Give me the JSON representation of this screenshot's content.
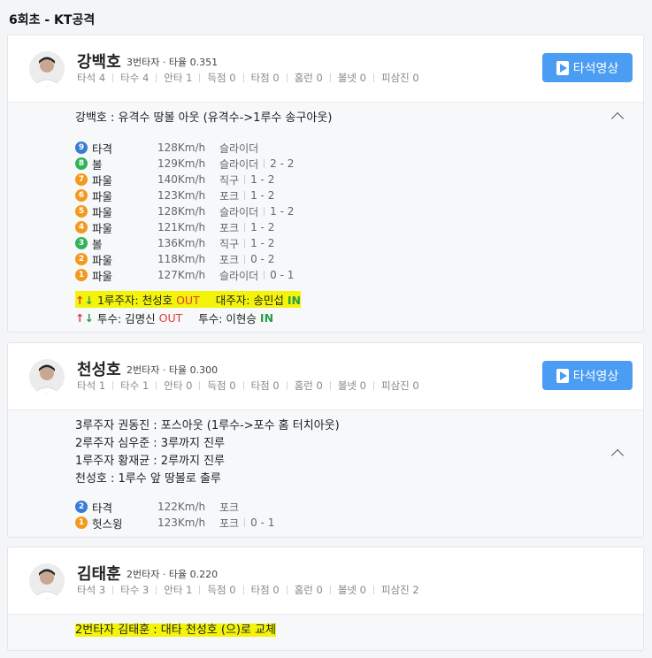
{
  "inning": {
    "title": "6회초 - KT공격"
  },
  "colors": {
    "accent": "#4a9df2",
    "out": "#e03b3b",
    "in": "#2a9d4a",
    "highlight": "#f4f40a"
  },
  "batters": [
    {
      "name": "강백호",
      "order": "3번타자 · 타율 0.351",
      "stats": [
        "타석 4",
        "타수 4",
        "안타 1",
        "득점 0",
        "타점 0",
        "홈런 0",
        "볼넷 0",
        "피삼진 0"
      ],
      "video_label": "타석영상",
      "result": "강백호 : 유격수 땅볼 아웃 (유격수->1루수 송구아웃)",
      "pitches": [
        {
          "n": "9",
          "c": "blue",
          "res": "타격",
          "speed": "128Km/h",
          "type": "슬라이더",
          "count": ""
        },
        {
          "n": "8",
          "c": "green",
          "res": "볼",
          "speed": "129Km/h",
          "type": "슬라이더",
          "count": "2 - 2"
        },
        {
          "n": "7",
          "c": "orange",
          "res": "파울",
          "speed": "140Km/h",
          "type": "직구",
          "count": "1 - 2"
        },
        {
          "n": "6",
          "c": "orange",
          "res": "파울",
          "speed": "123Km/h",
          "type": "포크",
          "count": "1 - 2"
        },
        {
          "n": "5",
          "c": "orange",
          "res": "파울",
          "speed": "128Km/h",
          "type": "슬라이더",
          "count": "1 - 2"
        },
        {
          "n": "4",
          "c": "orange",
          "res": "파울",
          "speed": "121Km/h",
          "type": "포크",
          "count": "1 - 2"
        },
        {
          "n": "3",
          "c": "green",
          "res": "볼",
          "speed": "136Km/h",
          "type": "직구",
          "count": "1 - 2"
        },
        {
          "n": "2",
          "c": "orange",
          "res": "파울",
          "speed": "118Km/h",
          "type": "포크",
          "count": "0 - 2"
        },
        {
          "n": "1",
          "c": "orange",
          "res": "파울",
          "speed": "127Km/h",
          "type": "슬라이더",
          "count": "0 - 1"
        }
      ],
      "subs": [
        {
          "label1": "1루주자: 천성호",
          "out": "OUT",
          "label2": "대주자: 송민섭",
          "in": "IN"
        },
        {
          "label1": "투수: 김명신",
          "out": "OUT",
          "label2": "투수: 이현승",
          "in": "IN"
        }
      ]
    },
    {
      "name": "천성호",
      "order": "2번타자 · 타율 0.300",
      "stats": [
        "타석 1",
        "타수 1",
        "안타 0",
        "득점 0",
        "타점 0",
        "홈런 0",
        "볼넷 0",
        "피삼진 0"
      ],
      "video_label": "타석영상",
      "results": [
        "3루주자 권동진 : 포스아웃 (1루수->포수 홈 터치아웃)",
        "2루주자 심우준 : 3루까지 진루",
        "1루주자 황재균 : 2루까지 진루",
        "천성호 : 1루수 앞 땅볼로 출루"
      ],
      "pitches": [
        {
          "n": "2",
          "c": "blue",
          "res": "타격",
          "speed": "122Km/h",
          "type": "포크",
          "count": ""
        },
        {
          "n": "1",
          "c": "orange",
          "res": "헛스윙",
          "speed": "123Km/h",
          "type": "포크",
          "count": "0 - 1"
        }
      ]
    },
    {
      "name": "김태훈",
      "order": "2번타자 · 타율 0.220",
      "stats": [
        "타석 3",
        "타수 3",
        "안타 1",
        "득점 0",
        "타점 0",
        "홈런 0",
        "볼넷 0",
        "피삼진 2"
      ],
      "note": "2번타자 김태훈 : 대타 천성호 (으)로 교체"
    }
  ]
}
